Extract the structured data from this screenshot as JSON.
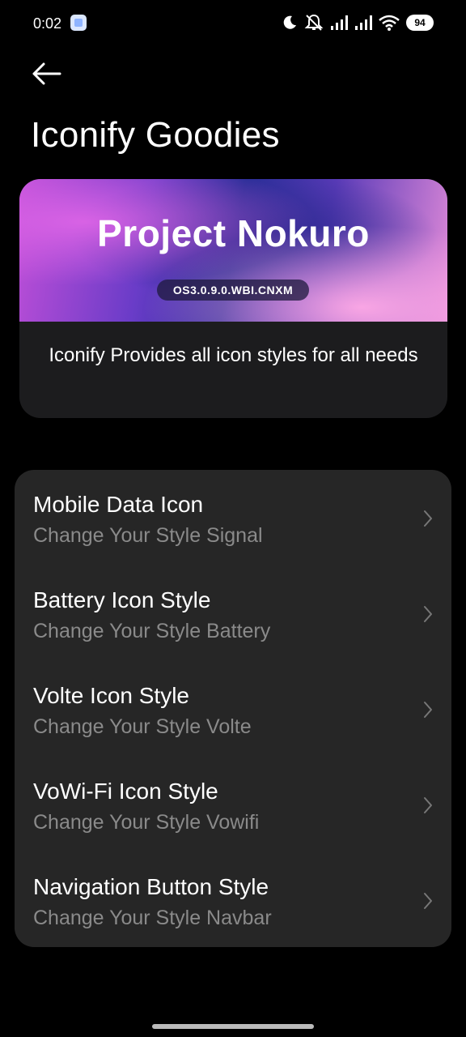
{
  "status_bar": {
    "time": "0:02",
    "battery": "94",
    "icons": [
      "moon-icon",
      "mute-icon",
      "signal-icon",
      "signal-icon",
      "wifi-icon"
    ]
  },
  "header": {
    "back_icon": "arrow-left-icon",
    "title": "Iconify Goodies"
  },
  "banner": {
    "title": "Project Nokuro",
    "version": "OS3.0.9.0.WBI.CNXM",
    "description": "Iconify Provides all icon styles for all needs"
  },
  "list": {
    "items": [
      {
        "title": "Mobile Data Icon",
        "subtitle": "Change Your Style Signal"
      },
      {
        "title": "Battery Icon Style",
        "subtitle": "Change Your Style Battery"
      },
      {
        "title": "Volte Icon Style",
        "subtitle": "Change Your Style Volte"
      },
      {
        "title": "VoWi-Fi Icon Style",
        "subtitle": "Change Your Style Vowifi"
      },
      {
        "title": "Navigation Button Style",
        "subtitle": "Change Your Style Navbar"
      }
    ]
  },
  "colors": {
    "background": "#000000",
    "card": "#262626",
    "subtitle": "#8a8a8a"
  }
}
